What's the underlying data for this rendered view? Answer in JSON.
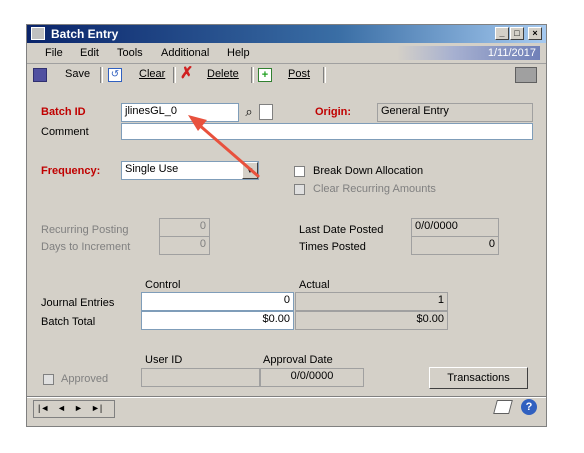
{
  "window": {
    "title": "Batch Entry"
  },
  "menu": {
    "items": [
      "File",
      "Edit",
      "Tools",
      "Additional",
      "Help"
    ],
    "date": "1/11/2017"
  },
  "toolbar": {
    "save": "Save",
    "clear": "Clear",
    "delete": "Delete",
    "post": "Post"
  },
  "form": {
    "batch_id_label": "Batch ID",
    "batch_id_value": "jlinesGL_0",
    "origin_label": "Origin:",
    "origin_value": "General Entry",
    "comment_label": "Comment",
    "comment_value": "",
    "frequency_label": "Frequency:",
    "frequency_value": "Single Use",
    "break_down_label": "Break Down Allocation",
    "clear_recurring_label": "Clear Recurring Amounts",
    "recurring_posting_label": "Recurring Posting",
    "recurring_posting_value": "0",
    "days_to_increment_label": "Days to Increment",
    "days_to_increment_value": "0",
    "last_date_posted_label": "Last Date Posted",
    "last_date_posted_value": "0/0/0000",
    "times_posted_label": "Times Posted",
    "times_posted_value": "0"
  },
  "totals": {
    "control_header": "Control",
    "actual_header": "Actual",
    "journal_entries_label": "Journal Entries",
    "journal_entries_control": "0",
    "journal_entries_actual": "1",
    "batch_total_label": "Batch Total",
    "batch_total_control": "$0.00",
    "batch_total_actual": "$0.00"
  },
  "approval": {
    "user_id_header": "User ID",
    "approval_date_header": "Approval Date",
    "approved_label": "Approved",
    "user_id_value": "",
    "approval_date_value": "0/0/0000",
    "transactions_button": "Transactions"
  },
  "nav": {
    "first": "|◄",
    "prev": "◄",
    "next": "►",
    "last": "►|"
  },
  "colors": {
    "required": "#c00000",
    "title_bar": "#0a246a",
    "arrow": "#e8513d"
  }
}
